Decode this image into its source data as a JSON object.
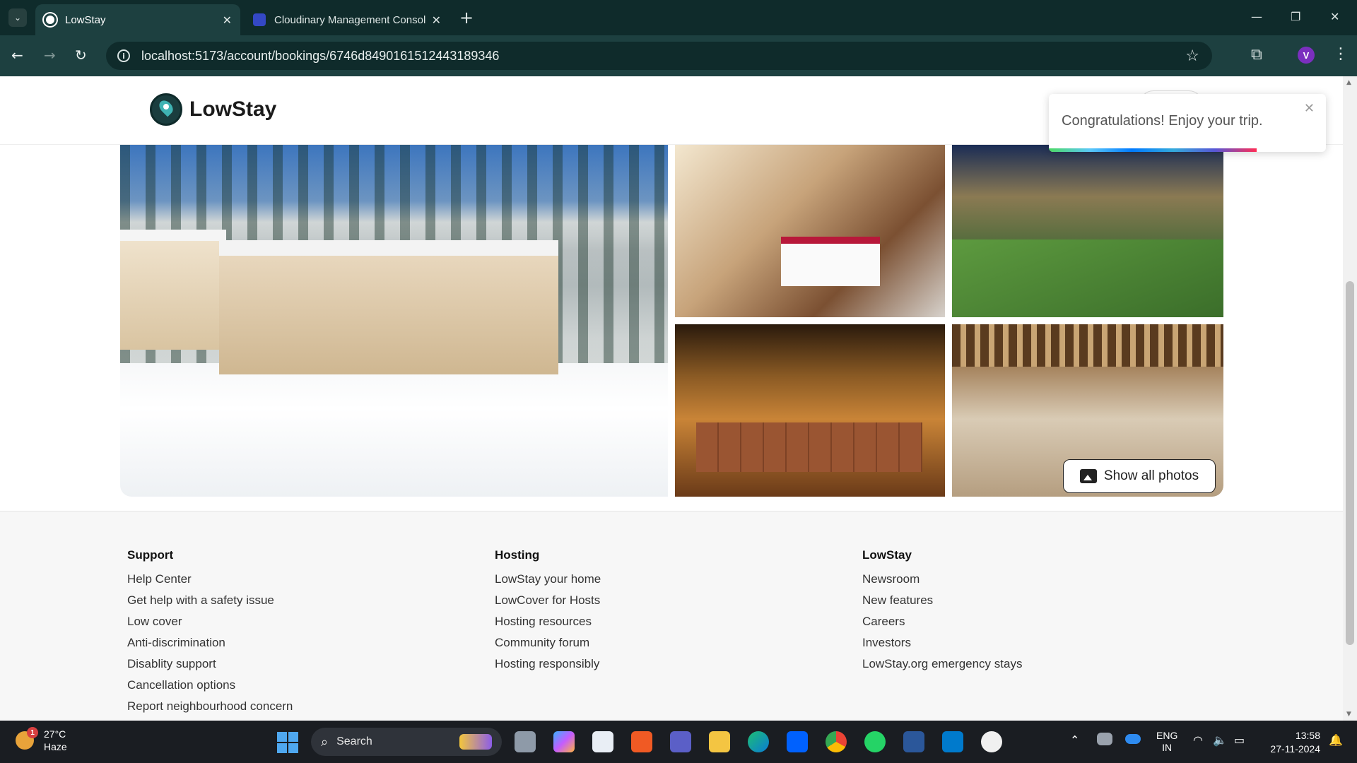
{
  "browser": {
    "tabs": [
      {
        "label": "LowStay",
        "active": true
      },
      {
        "label": "Cloudinary Management Console",
        "active": false
      }
    ],
    "new_tab_glyph": "+",
    "tab_close_glyph": "✕",
    "address": "localhost:5173/account/bookings/6746d8490161512443189346",
    "profile_initial": "V",
    "window_controls": [
      "—",
      "❐",
      "✕"
    ]
  },
  "header": {
    "brand": "LowStay",
    "logo_icon": "map-pin-logo-icon"
  },
  "toast": {
    "message": "Congratulations! Enjoy your trip.",
    "close_glyph": "✕",
    "progress_remaining": 0.75
  },
  "gallery": {
    "photos": [
      {
        "name": "hotel-exterior-snow-photo"
      },
      {
        "name": "bedroom-photo"
      },
      {
        "name": "courtyard-photo"
      },
      {
        "name": "restaurant-buffet-photo"
      },
      {
        "name": "lobby-lounge-photo"
      }
    ],
    "show_all_label": "Show all photos"
  },
  "footer": {
    "columns": [
      {
        "heading": "Support",
        "links": [
          "Help Center",
          "Get help with a safety issue",
          "Low cover",
          "Anti-discrimination",
          "Disablity support",
          "Cancellation options",
          "Report neighbourhood concern"
        ]
      },
      {
        "heading": "Hosting",
        "links": [
          "LowStay your home",
          "LowCover for Hosts",
          "Hosting resources",
          "Community forum",
          "Hosting responsibly"
        ]
      },
      {
        "heading": "LowStay",
        "links": [
          "Newsroom",
          "New features",
          "Careers",
          "Investors",
          "LowStay.org emergency stays"
        ]
      }
    ]
  },
  "taskbar": {
    "weather": {
      "temp": "27°C",
      "condition": "Haze",
      "badge": "1"
    },
    "search_label": "Search",
    "language": {
      "line1": "ENG",
      "line2": "IN"
    },
    "clock": {
      "time": "13:58",
      "date": "27-11-2024"
    },
    "apps": [
      "file-explorer-icon",
      "copilot-icon",
      "store-icon",
      "brave-icon",
      "teams-icon",
      "folder-icon",
      "edge-icon",
      "dropbox-icon",
      "chrome-icon",
      "whatsapp-icon",
      "word-icon",
      "vscode-icon",
      "mongodb-icon"
    ],
    "colors": {
      "accent": "#4fa8f0",
      "tabbar": "#0f2b2b",
      "chrome": "#1d4040"
    }
  }
}
